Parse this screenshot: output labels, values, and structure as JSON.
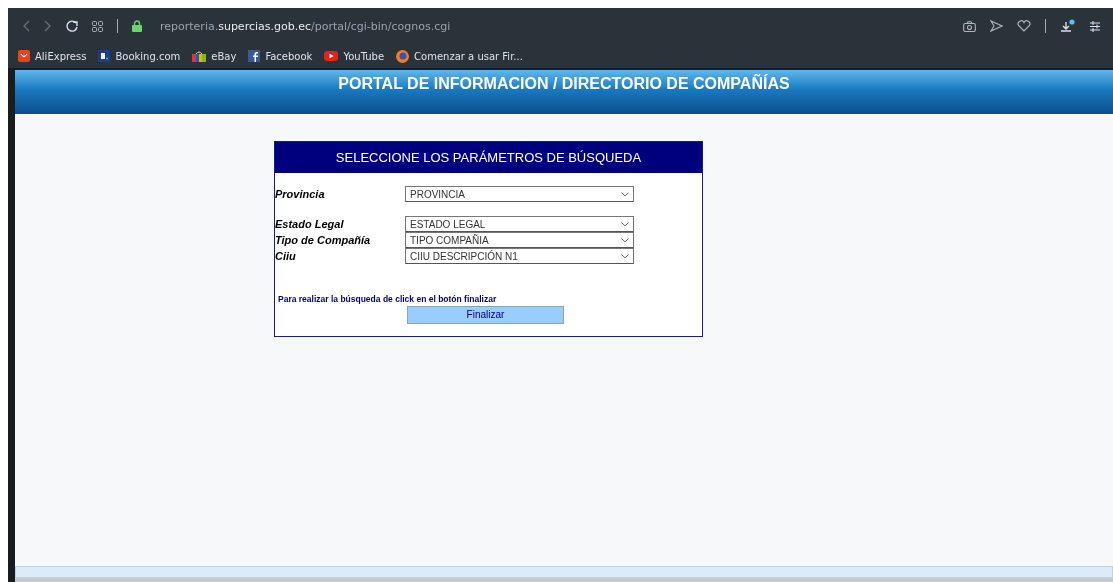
{
  "browser": {
    "url": {
      "prefix": "reporteria.",
      "domain": "supercias.gob.ec",
      "path": "/portal/cgi-bin/cognos.cgi"
    },
    "downloads_badge": true,
    "bookmarks": [
      {
        "label": "AliExpress",
        "kind": "aliexpress"
      },
      {
        "label": "Booking.com",
        "kind": "booking"
      },
      {
        "label": "eBay",
        "kind": "bag"
      },
      {
        "label": "Facebook",
        "kind": "facebook"
      },
      {
        "label": "YouTube",
        "kind": "youtube"
      },
      {
        "label": "Comenzar a usar Fir...",
        "kind": "firefox"
      }
    ]
  },
  "banner": {
    "title": "PORTAL DE INFORMACION / DIRECTORIO DE COMPAÑÍAS"
  },
  "form": {
    "title": "SELECCIONE LOS PARÁMETROS DE BÚSQUEDA",
    "field_groups": [
      [
        {
          "label": "Provincia",
          "value": "PROVINCIA"
        }
      ],
      [
        {
          "label": "Estado Legal",
          "value": "ESTADO LEGAL"
        },
        {
          "label": "Tipo de Compañía",
          "value": "TIPO COMPAÑIA"
        },
        {
          "label": "Ciiu",
          "value": "CIIU DESCRIPCIÓN N1"
        }
      ]
    ],
    "hint": "Para realizar la búsqueda de click en el botón finalizar",
    "button": "Finalizar"
  }
}
